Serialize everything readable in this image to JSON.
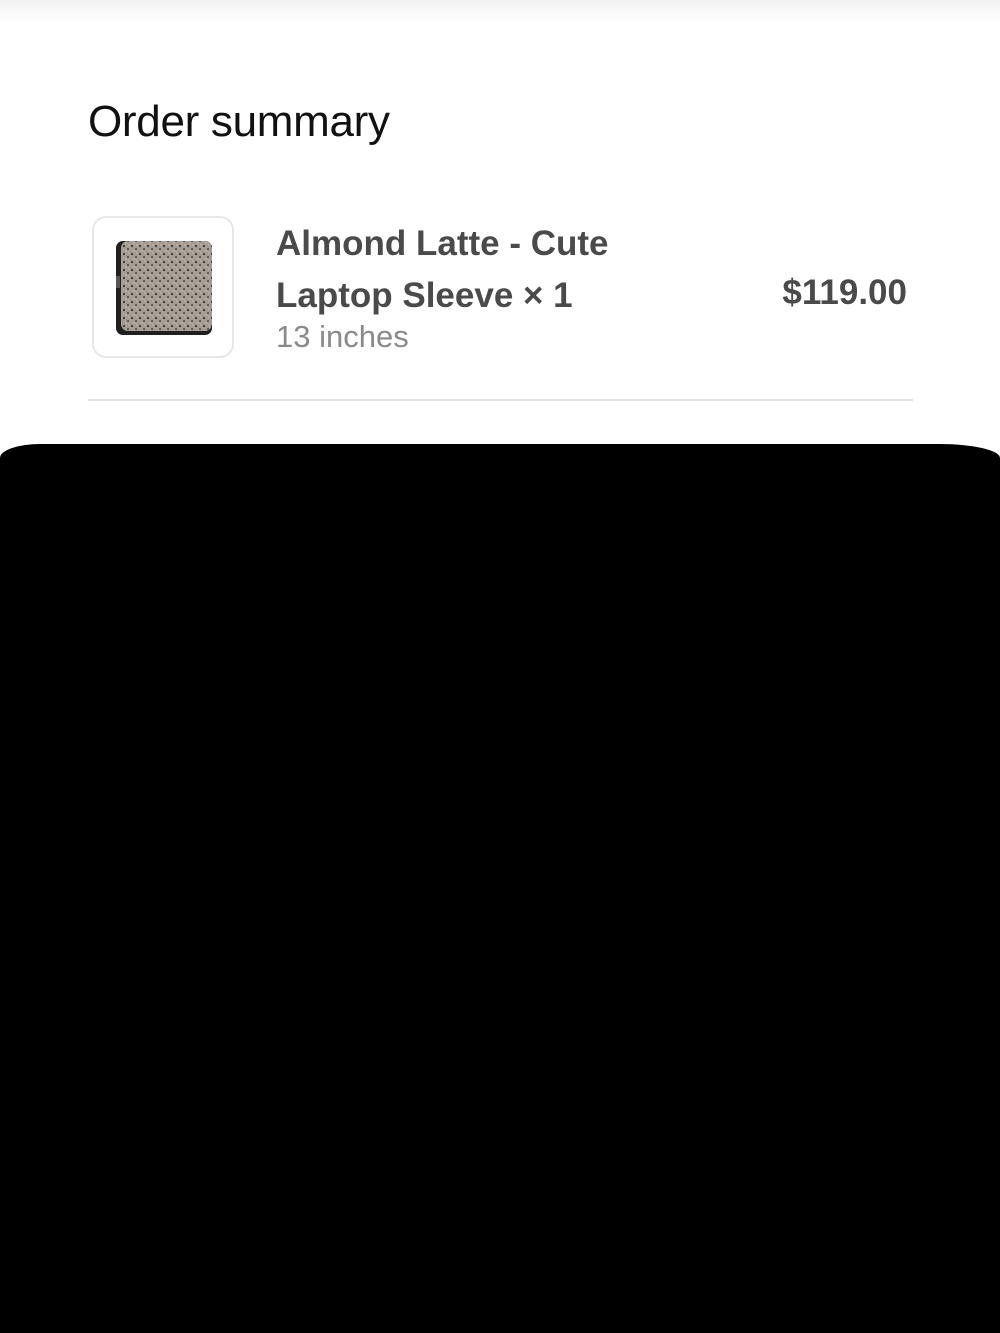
{
  "order_summary": {
    "title": "Order summary",
    "items": [
      {
        "name": "Almond Latte - Cute Laptop Sleeve × 1",
        "variant": "13 inches",
        "price": "$119.00",
        "thumbnail_icon": "laptop-sleeve-image"
      }
    ]
  },
  "colors": {
    "text_primary": "#111111",
    "text_item": "#4a4a4a",
    "text_muted": "#8a8a8a",
    "divider": "#e4e4e4",
    "redaction": "#000000"
  }
}
